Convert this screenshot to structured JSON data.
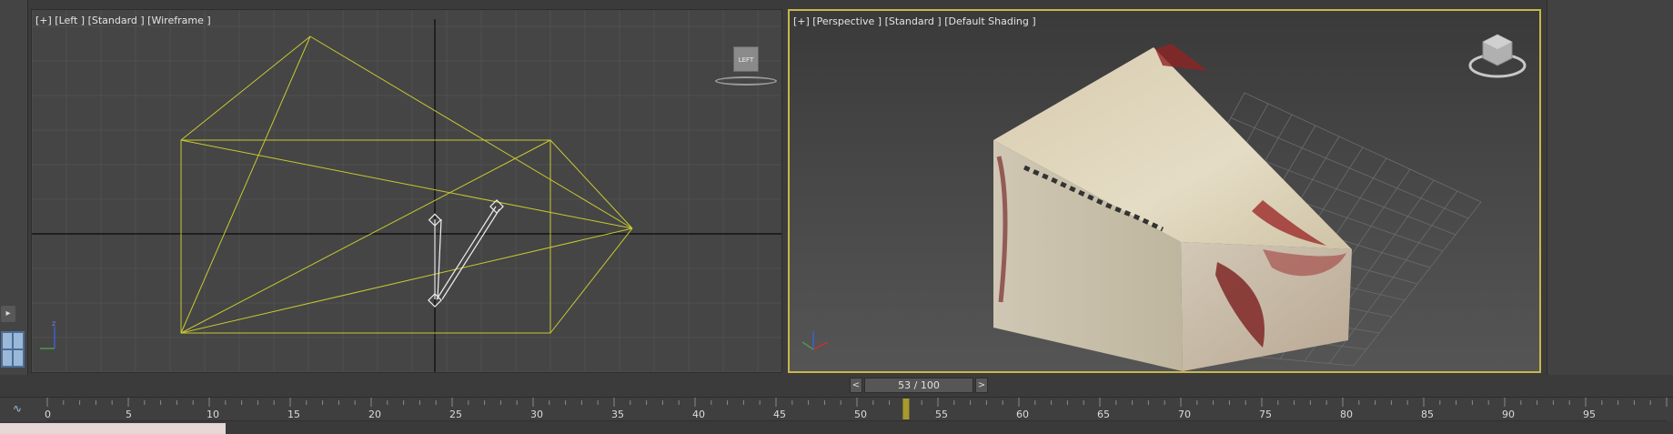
{
  "viewports": {
    "left": {
      "label": "[+] [Left ] [Standard ] [Wireframe ]",
      "viewcube_face": "LEFT"
    },
    "perspective": {
      "label": "[+] [Perspective ] [Standard ] [Default Shading ]"
    }
  },
  "time_slider": {
    "prev": "<",
    "value": "53 / 100",
    "next": ">"
  },
  "trackbar": {
    "ticks": [
      "0",
      "5",
      "10",
      "15",
      "20",
      "25",
      "30",
      "35",
      "40",
      "45",
      "50",
      "55",
      "60",
      "65",
      "70",
      "75",
      "80",
      "85",
      "90",
      "95"
    ],
    "current_frame": 53,
    "total_frames": 100,
    "icon": "curve-editor-icon"
  },
  "colors": {
    "wireframe": "#c8c832",
    "selection_border": "#c8b74a",
    "frame_marker": "#a89a2a",
    "viewport_bg": "#454545"
  },
  "icons": [
    "viewcube-icon",
    "axis-tripod-icon",
    "camera-icon",
    "expand-arrow-icon",
    "layout-icon"
  ]
}
